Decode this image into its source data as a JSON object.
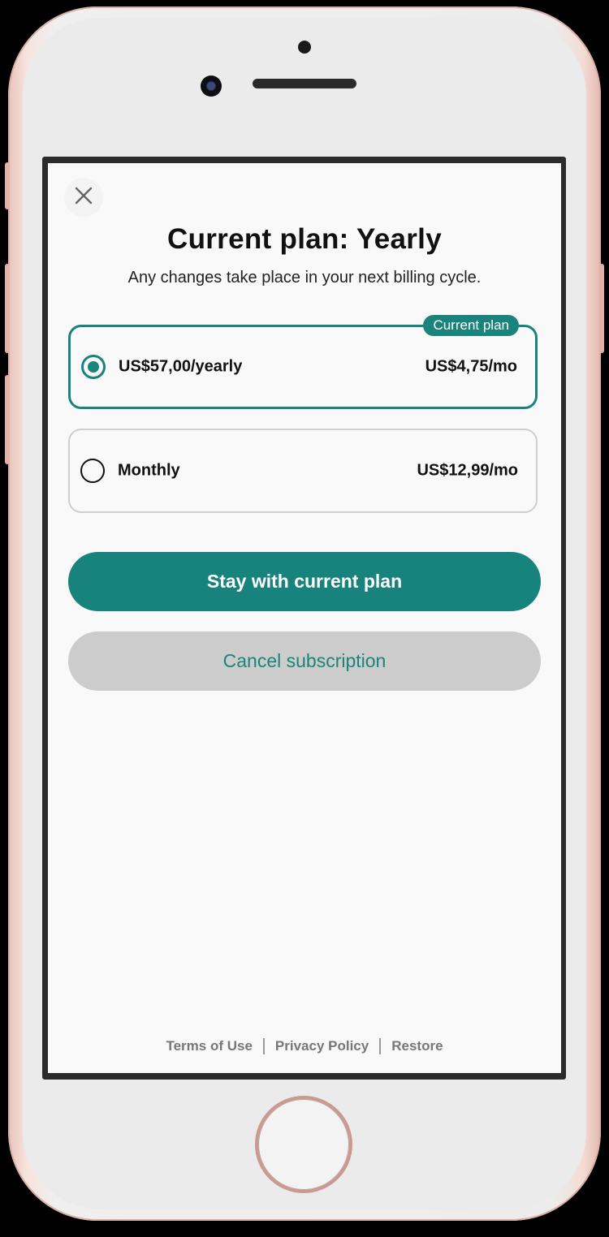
{
  "header": {
    "title": "Current plan: Yearly",
    "subtitle": "Any changes take place in your next billing cycle."
  },
  "plans": [
    {
      "label": "US$57,00/yearly",
      "price": "US$4,75/mo",
      "badge": "Current plan",
      "selected": true
    },
    {
      "label": "Monthly",
      "price": "US$12,99/mo",
      "selected": false
    }
  ],
  "actions": {
    "primary_label": "Stay with current plan",
    "secondary_label": "Cancel subscription"
  },
  "footer": {
    "links": [
      "Terms of Use",
      "Privacy Policy",
      "Restore"
    ]
  },
  "colors": {
    "accent": "#1a847c",
    "secondary_button_bg": "#cccccc",
    "screen_bg": "#f9f9f9"
  },
  "icons": {
    "close": "close-icon"
  }
}
